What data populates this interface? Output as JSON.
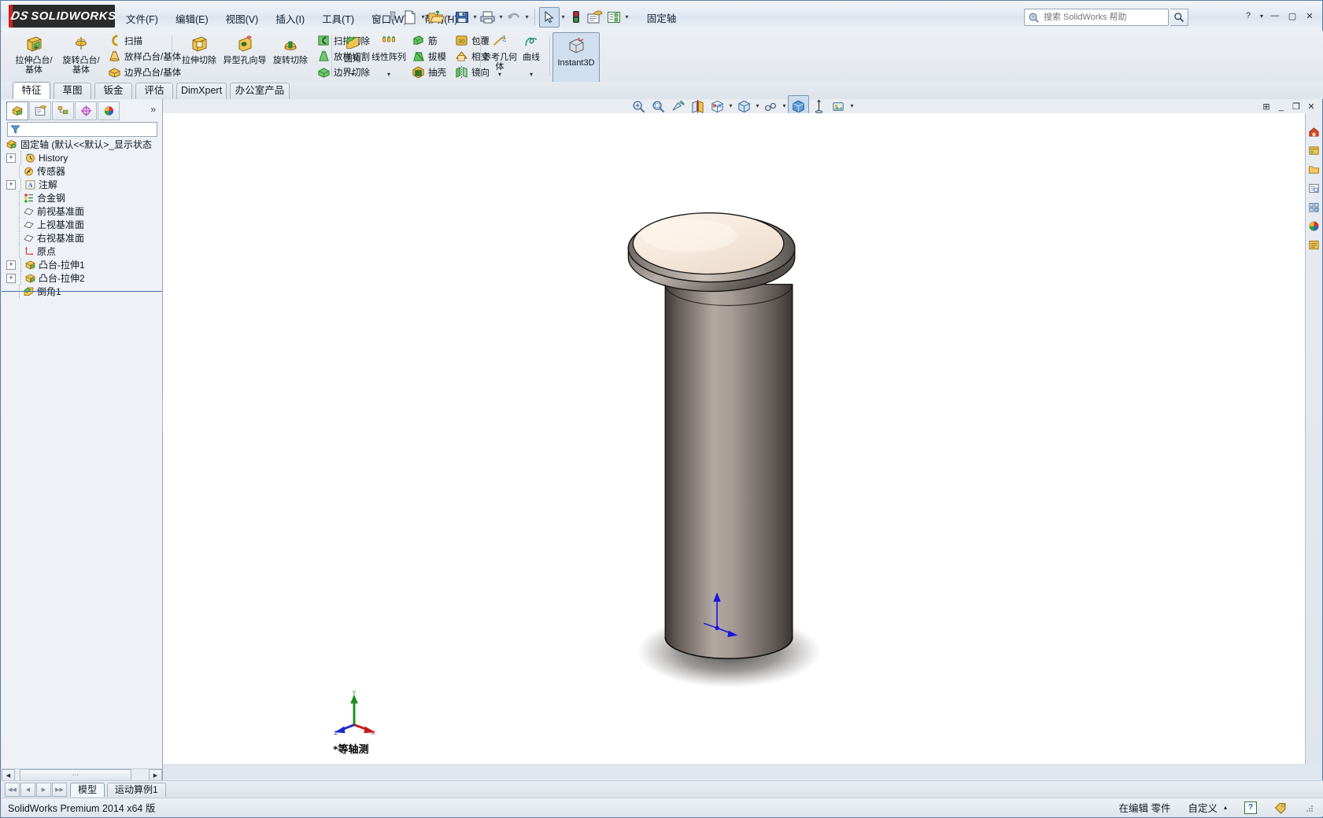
{
  "app": {
    "brand": "SOLIDWORKS",
    "brand_prefix": "DS",
    "document_title": "固定轴",
    "status_version": "SolidWorks Premium 2014 x64 版"
  },
  "menu": {
    "items": [
      {
        "label": "文件(F)",
        "name": "menu-file"
      },
      {
        "label": "编辑(E)",
        "name": "menu-edit"
      },
      {
        "label": "视图(V)",
        "name": "menu-view"
      },
      {
        "label": "插入(I)",
        "name": "menu-insert"
      },
      {
        "label": "工具(T)",
        "name": "menu-tools"
      },
      {
        "label": "窗口(W)",
        "name": "menu-window"
      },
      {
        "label": "帮助(H)",
        "name": "menu-help"
      }
    ]
  },
  "quick_toolbar": {
    "items": [
      {
        "name": "new-document-icon",
        "has_caret": true
      },
      {
        "name": "open-document-icon",
        "has_caret": true
      },
      {
        "name": "save-icon",
        "has_caret": true
      },
      {
        "name": "print-icon",
        "has_caret": true
      },
      {
        "name": "undo-icon",
        "has_caret": true
      },
      {
        "name": "select-arrow-icon",
        "has_caret": true
      },
      {
        "name": "rebuild-traffic-light-icon",
        "has_caret": false
      },
      {
        "name": "options-icon",
        "has_caret": false
      },
      {
        "name": "properties-icon",
        "has_caret": true
      }
    ]
  },
  "search": {
    "placeholder": "搜索 SolidWorks 帮助",
    "value": ""
  },
  "window_buttons": {
    "help": "?",
    "help_caret": "▾",
    "minimize": "—",
    "maximize": "▢",
    "close": "✕"
  },
  "ribbon": {
    "groups": [
      {
        "name": "boss-group",
        "big": [
          {
            "label": "拉伸凸台/基体",
            "name": "extruded-boss-base-button",
            "icon": "extrude-boss-icon"
          },
          {
            "label": "旋转凸台/基体",
            "name": "revolved-boss-base-button",
            "icon": "revolve-boss-icon"
          }
        ],
        "small": [
          {
            "label": "扫描",
            "name": "swept-boss-button",
            "icon": "sweep-icon"
          },
          {
            "label": "放样凸台/基体",
            "name": "lofted-boss-button",
            "icon": "loft-icon"
          },
          {
            "label": "边界凸台/基体",
            "name": "boundary-boss-button",
            "icon": "boundary-icon"
          }
        ]
      },
      {
        "name": "cut-group",
        "big": [
          {
            "label": "拉伸切除",
            "name": "extruded-cut-button",
            "icon": "extrude-cut-icon"
          },
          {
            "label": "异型孔向导",
            "name": "hole-wizard-button",
            "icon": "hole-wizard-icon"
          },
          {
            "label": "旋转切除",
            "name": "revolved-cut-button",
            "icon": "revolve-cut-icon"
          }
        ],
        "small": [
          {
            "label": "扫描切除",
            "name": "swept-cut-button",
            "icon": "sweep-cut-icon"
          },
          {
            "label": "放样切割",
            "name": "lofted-cut-button",
            "icon": "loft-cut-icon"
          },
          {
            "label": "边界切除",
            "name": "boundary-cut-button",
            "icon": "boundary-cut-icon"
          }
        ]
      },
      {
        "name": "feature-group",
        "big": [
          {
            "label": "圆角",
            "name": "fillet-button",
            "icon": "fillet-icon",
            "caret": true
          },
          {
            "label": "线性阵列",
            "name": "linear-pattern-button",
            "icon": "linear-pattern-icon",
            "caret": true
          }
        ],
        "small": [
          {
            "label": "筋",
            "name": "rib-button",
            "icon": "rib-icon"
          },
          {
            "label": "拔模",
            "name": "draft-button",
            "icon": "draft-icon"
          },
          {
            "label": "抽壳",
            "name": "shell-button",
            "icon": "shell-icon"
          }
        ],
        "small2": [
          {
            "label": "包覆",
            "name": "wrap-button",
            "icon": "wrap-icon"
          },
          {
            "label": "相交",
            "name": "intersect-button",
            "icon": "intersect-icon"
          },
          {
            "label": "镜向",
            "name": "mirror-button",
            "icon": "mirror-icon"
          }
        ]
      },
      {
        "name": "reference-group",
        "big": [
          {
            "label": "参考几何体",
            "name": "reference-geometry-button",
            "icon": "reference-geometry-icon",
            "caret": true
          },
          {
            "label": "曲线",
            "name": "curves-button",
            "icon": "curves-icon",
            "caret": true
          }
        ]
      },
      {
        "name": "instant3d-group",
        "big": [
          {
            "label": "Instant3D",
            "name": "instant3d-button",
            "icon": "instant3d-icon"
          }
        ]
      }
    ]
  },
  "command_tabs": {
    "items": [
      {
        "label": "特征",
        "name": "tab-features",
        "active": true
      },
      {
        "label": "草图",
        "name": "tab-sketch",
        "active": false
      },
      {
        "label": "钣金",
        "name": "tab-sheet-metal",
        "active": false
      },
      {
        "label": "评估",
        "name": "tab-evaluate",
        "active": false
      },
      {
        "label": "DimXpert",
        "name": "tab-dimxpert",
        "active": false
      },
      {
        "label": "办公室产品",
        "name": "tab-office-products",
        "active": false
      }
    ]
  },
  "panel_tabs": {
    "items": [
      {
        "name": "feature-manager-tab",
        "active": true
      },
      {
        "name": "property-manager-tab",
        "active": false
      },
      {
        "name": "configuration-manager-tab",
        "active": false
      },
      {
        "name": "dimxpert-manager-tab",
        "active": false
      },
      {
        "name": "display-manager-tab",
        "active": false
      }
    ],
    "chevron": "»"
  },
  "feature_tree": {
    "root": {
      "label": "固定轴  (默认<<默认>_显示状态",
      "name": "tree-root-part",
      "icon": "part-icon"
    },
    "items": [
      {
        "label": "History",
        "name": "tree-item-history",
        "icon": "history-icon",
        "expandable": true,
        "indent": 1
      },
      {
        "label": "传感器",
        "name": "tree-item-sensors",
        "icon": "sensor-icon",
        "expandable": false,
        "indent": 1
      },
      {
        "label": "注解",
        "name": "tree-item-annotations",
        "icon": "annotations-icon",
        "expandable": true,
        "indent": 1
      },
      {
        "label": "合金钢",
        "name": "tree-item-material",
        "icon": "material-icon",
        "expandable": false,
        "indent": 1
      },
      {
        "label": "前视基准面",
        "name": "tree-item-front-plane",
        "icon": "plane-icon",
        "expandable": false,
        "indent": 1
      },
      {
        "label": "上视基准面",
        "name": "tree-item-top-plane",
        "icon": "plane-icon",
        "expandable": false,
        "indent": 1
      },
      {
        "label": "右视基准面",
        "name": "tree-item-right-plane",
        "icon": "plane-icon",
        "expandable": false,
        "indent": 1
      },
      {
        "label": "原点",
        "name": "tree-item-origin",
        "icon": "origin-icon",
        "expandable": false,
        "indent": 1
      },
      {
        "label": "凸台-拉伸1",
        "name": "tree-item-boss-extrude1",
        "icon": "extrude-feature-icon",
        "expandable": true,
        "indent": 1
      },
      {
        "label": "凸台-拉伸2",
        "name": "tree-item-boss-extrude2",
        "icon": "extrude-feature-icon",
        "expandable": true,
        "indent": 1
      },
      {
        "label": "倒角1",
        "name": "tree-item-chamfer1",
        "icon": "chamfer-icon",
        "expandable": false,
        "indent": 1
      }
    ]
  },
  "filter": {
    "placeholder": "",
    "icon": "filter-funnel-icon"
  },
  "view_toolbar": {
    "items": [
      {
        "name": "zoom-to-fit-icon",
        "caret": false
      },
      {
        "name": "zoom-to-area-icon",
        "caret": false
      },
      {
        "name": "previous-view-icon",
        "caret": false
      },
      {
        "name": "section-view-icon",
        "caret": false
      },
      {
        "name": "view-orientation-icon",
        "caret": true
      },
      {
        "name": "display-style-icon",
        "caret": true
      },
      {
        "name": "hide-show-items-icon",
        "caret": true
      },
      {
        "name": "apply-scene-icon",
        "caret": false,
        "active": true
      },
      {
        "name": "view-settings-icon",
        "caret": false
      },
      {
        "name": "appearance-icon",
        "caret": true
      }
    ]
  },
  "graphics_window_buttons": {
    "restore_all": "⊞",
    "minimize": "_",
    "restore": "❐",
    "close": "✕"
  },
  "viewport": {
    "orientation_label": "*等轴测",
    "triad": {
      "x": "X",
      "y": "Y",
      "z": "Z"
    },
    "model": {
      "name": "固定轴",
      "top_face_color": "#f2e4d5",
      "chamfer_color": "#c4bcb8",
      "shaft_color": "#6b6460",
      "shaft_highlight": "#b5aaa4",
      "edge_color": "#1a1a1a",
      "shadow_color": "#4a4a4a"
    },
    "origin_triad_color": "#1717e0"
  },
  "task_pane": {
    "items": [
      {
        "name": "solidworks-resources-icon"
      },
      {
        "name": "design-library-icon"
      },
      {
        "name": "file-explorer-icon"
      },
      {
        "name": "search-tab-icon"
      },
      {
        "name": "view-palette-icon"
      },
      {
        "name": "appearances-scenes-icon"
      },
      {
        "name": "custom-properties-icon"
      }
    ]
  },
  "bottom_tabs": {
    "nav": [
      "⏮",
      "◀",
      "▶",
      "⏭"
    ],
    "items": [
      {
        "label": "模型",
        "name": "bottom-tab-model",
        "active": true
      },
      {
        "label": "运动算例1",
        "name": "bottom-tab-motion-study-1",
        "active": false
      }
    ]
  },
  "status_bar": {
    "left": "SolidWorks Premium 2014 x64 版",
    "editing": "在编辑 零件",
    "custom": "自定义",
    "custom_caret": "▴",
    "help_badge": "?",
    "tag_icon": "tag-icon"
  },
  "colors": {
    "accent": "#d0201a",
    "titlebar": "#e4eaf2",
    "panel": "#eef1f5",
    "graphics_bg": "#ffffff",
    "tree_select": "#4a6fa5"
  }
}
